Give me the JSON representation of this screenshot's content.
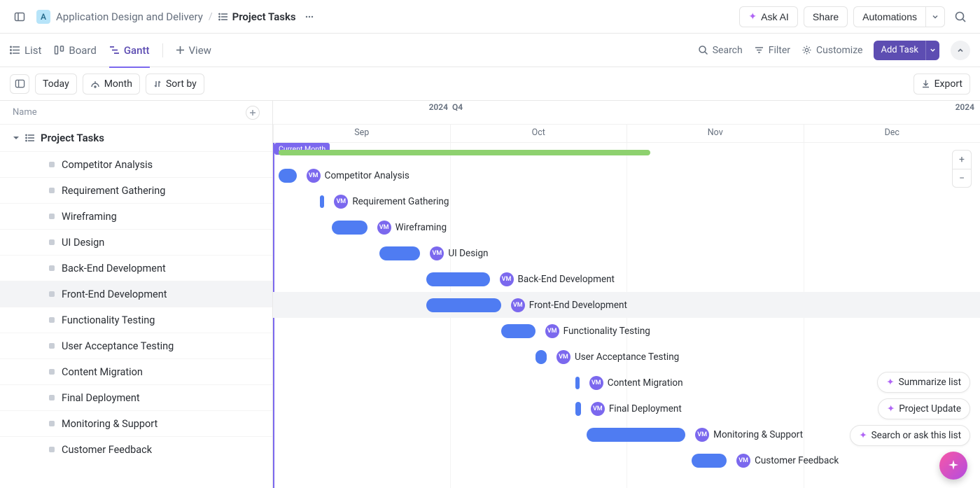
{
  "breadcrumb": {
    "workspace_initial": "A",
    "workspace": "Application Design and Delivery",
    "page": "Project Tasks"
  },
  "top_actions": {
    "ask_ai": "Ask AI",
    "share": "Share",
    "automations": "Automations"
  },
  "views": {
    "list": "List",
    "board": "Board",
    "gantt": "Gantt",
    "add_view": "View"
  },
  "view_toolbar": {
    "search": "Search",
    "filter": "Filter",
    "customize": "Customize",
    "add_task": "Add Task"
  },
  "gantt_toolbar": {
    "today": "Today",
    "month": "Month",
    "sort_by": "Sort by",
    "export": "Export"
  },
  "left_header": "Name",
  "group_title": "Project Tasks",
  "tasks": [
    {
      "name": "Competitor Analysis"
    },
    {
      "name": "Requirement Gathering"
    },
    {
      "name": "Wireframing"
    },
    {
      "name": "UI Design"
    },
    {
      "name": "Back-End Development"
    },
    {
      "name": "Front-End Development"
    },
    {
      "name": "Functionality Testing"
    },
    {
      "name": "User Acceptance Testing"
    },
    {
      "name": "Content Migration"
    },
    {
      "name": "Final Deployment"
    },
    {
      "name": "Monitoring & Support"
    },
    {
      "name": "Customer Feedback"
    }
  ],
  "timeline": {
    "year_left": "2024",
    "quarter": "Q4",
    "year_right": "2024",
    "months": [
      "Sep",
      "Oct",
      "Nov",
      "Dec"
    ],
    "current_label": "Current Month"
  },
  "assignee_initials": "VM",
  "zoom": {
    "in": "+",
    "out": "−"
  },
  "ai_chips": {
    "summarize": "Summarize list",
    "update": "Project Update",
    "search": "Search or ask this list"
  },
  "colors": {
    "primary": "#5d4db2",
    "bar": "#4f7cf2",
    "summary": "#8ed16f",
    "assignee": "#7b68ee"
  },
  "chart_data": {
    "type": "gantt",
    "time_axis": {
      "start": "2024-08-27",
      "end": "2024-12-31",
      "unit": "month"
    },
    "group": {
      "name": "Project Tasks",
      "start": "2024-09-02",
      "end": "2024-11-05"
    },
    "current_date": "2024-08-27",
    "assignee": "VM",
    "tasks": [
      {
        "name": "Competitor Analysis",
        "start": "2024-09-02",
        "end": "2024-09-05"
      },
      {
        "name": "Requirement Gathering",
        "start": "2024-09-09",
        "end": "2024-09-09"
      },
      {
        "name": "Wireframing",
        "start": "2024-09-11",
        "end": "2024-09-17"
      },
      {
        "name": "UI Design",
        "start": "2024-09-19",
        "end": "2024-09-26"
      },
      {
        "name": "Back-End Development",
        "start": "2024-09-27",
        "end": "2024-10-08"
      },
      {
        "name": "Front-End Development",
        "start": "2024-09-27",
        "end": "2024-10-10"
      },
      {
        "name": "Functionality Testing",
        "start": "2024-10-10",
        "end": "2024-10-16"
      },
      {
        "name": "User Acceptance Testing",
        "start": "2024-10-16",
        "end": "2024-10-18"
      },
      {
        "name": "Content Migration",
        "start": "2024-10-23",
        "end": "2024-10-23"
      },
      {
        "name": "Final Deployment",
        "start": "2024-10-23",
        "end": "2024-10-24"
      },
      {
        "name": "Monitoring & Support",
        "start": "2024-10-25",
        "end": "2024-11-11"
      },
      {
        "name": "Customer Feedback",
        "start": "2024-11-12",
        "end": "2024-11-18"
      }
    ]
  }
}
